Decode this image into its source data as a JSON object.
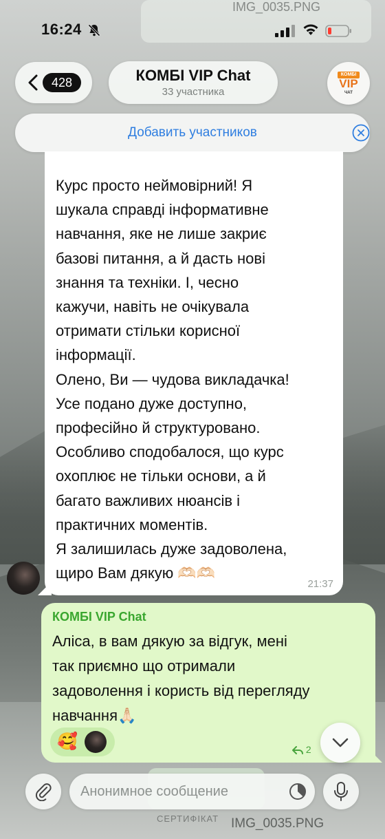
{
  "status_bar": {
    "time": "16:24"
  },
  "header": {
    "back_count": "428",
    "chat_title": "КОМБІ VIP Chat",
    "chat_subtitle": "33 участника",
    "avatar_top": "КОМБІ",
    "avatar_main": "VIP",
    "avatar_bottom": "ЧАТ"
  },
  "add_members": {
    "label": "Добавить участников"
  },
  "messages": [
    {
      "text": "Курс просто неймовірний! Я\nшукала справді інформативне\nнавчання, яке не лише закриє\nбазові питання, а й дасть нові\nзнання та техніки. І, чесно\nкажучи, навіть не очікувала\nотримати стільки корисної\nінформації.\nОлено, Ви — чудова викладачка!\nУсе подано дуже доступно,\nпрофесійно й структуровано.\nОсобливо сподобалося, що курс\nохоплює не тільки основи, а й\nбагато важливих нюансів і\nпрактичних моментів.\nЯ залишилась дуже задоволена,\nщиро Вам дякую 🫶🏻🫶🏻",
      "time": "21:37"
    },
    {
      "sender": "КОМБІ VIP Chat",
      "text": "Аліса, в вам дякую за відгук, мені\nтак приємно що отримали\nзадоволення і користь від перегляду\nнавчання🙏🏻",
      "reaction_emoji": "🥰",
      "forward_count": "2"
    }
  ],
  "background": {
    "file_name_top": "IMG_0035.PNG",
    "file_name_bottom": "IMG_0035.PNG",
    "cert_label": "СЕРТИФІКАТ"
  },
  "composer": {
    "placeholder": "Анонимное сообщение"
  },
  "icons": {
    "back": "chevron-left-icon",
    "close": "close-circle-icon",
    "attach": "paperclip-icon",
    "timer": "timer-icon",
    "mic": "microphone-icon",
    "scroll": "chevron-down-icon",
    "forward": "forward-arrow-icon",
    "mute": "bell-slash-icon"
  },
  "colors": {
    "link_blue": "#2f7ee0",
    "outgoing_bubble": "#e1f8c9",
    "sender_green": "#3aa72f",
    "battery_red": "#ff3b30"
  }
}
